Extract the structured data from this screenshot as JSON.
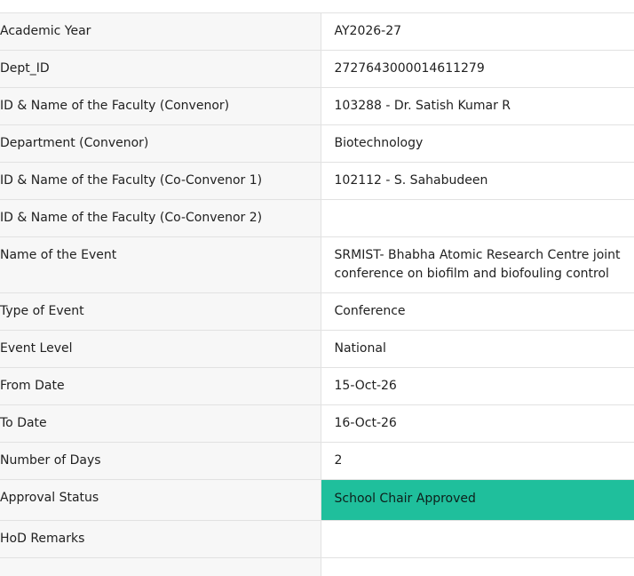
{
  "rows": [
    {
      "label": "Academic Year",
      "value": "AY2026-27"
    },
    {
      "label": "Dept_ID",
      "value": "2727643000014611279"
    },
    {
      "label": "ID & Name of the Faculty (Convenor)",
      "value": "103288 - Dr. Satish Kumar R"
    },
    {
      "label": "Department (Convenor)",
      "value": "Biotechnology"
    },
    {
      "label": "ID & Name of the Faculty (Co-Convenor 1)",
      "value": "102112 - S. Sahabudeen"
    },
    {
      "label": "ID & Name of the Faculty (Co-Convenor 2)",
      "value": ""
    },
    {
      "label": "Name of the Event",
      "value": "SRMIST- Bhabha Atomic Research Centre joint conference on biofilm and biofouling control"
    },
    {
      "label": "Type of Event",
      "value": "Conference"
    },
    {
      "label": "Event Level",
      "value": "National"
    },
    {
      "label": "From Date",
      "value": "15-Oct-26"
    },
    {
      "label": "To Date",
      "value": "16-Oct-26"
    },
    {
      "label": "Number of Days",
      "value": "2"
    },
    {
      "label": "Approval Status",
      "value": "School Chair Approved"
    },
    {
      "label": "HoD Remarks",
      "value": ""
    },
    {
      "label": "",
      "value": ""
    }
  ],
  "colors": {
    "approved_status": "#1fbf9c",
    "label_background": "#f7f7f7",
    "border": "#e2e2e2"
  }
}
